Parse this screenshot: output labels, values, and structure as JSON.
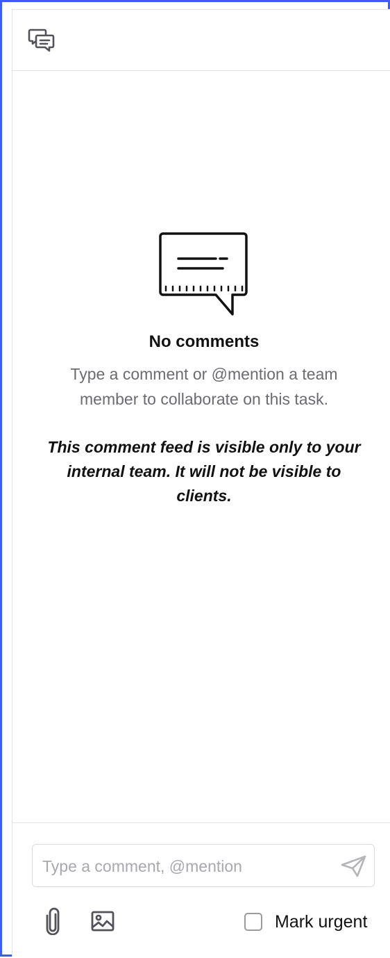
{
  "header": {
    "icon": "comments-icon"
  },
  "empty_state": {
    "illustration": "comment-bubble-illustration",
    "title": "No comments",
    "description": "Type a comment or @mention a team member to collaborate on this task.",
    "note": "This comment feed is visible only to your internal team. It will not be visible to clients."
  },
  "composer": {
    "placeholder": "Type a comment, @mention",
    "value": "",
    "send_icon": "send-icon",
    "attach_icon": "paperclip-icon",
    "image_icon": "image-icon",
    "urgent_label": "Mark urgent",
    "urgent_checked": false
  },
  "colors": {
    "frame_border": "#3b5bfd",
    "icon": "#52525b",
    "text_primary": "#111111",
    "text_muted": "#6b6b70"
  }
}
